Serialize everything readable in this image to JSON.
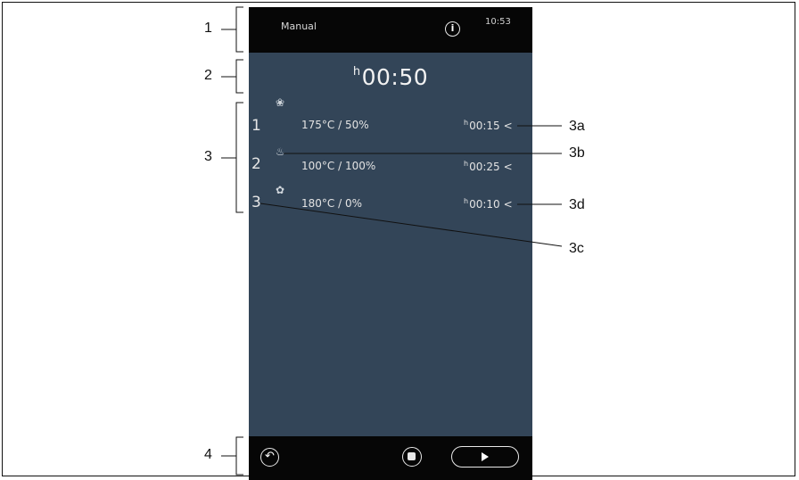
{
  "screen": {
    "mode_label": "Manual",
    "time": "10:53",
    "info_icon": "i",
    "total_time_prefix": "h",
    "total_time": "00:50",
    "steps": [
      {
        "number": "1",
        "icon": "hot-air-fan-icon",
        "icon_glyph": "❀",
        "setting": "175°C / 50%",
        "time_prefix": "h",
        "time": "00:15",
        "chevron": "<"
      },
      {
        "number": "2",
        "icon": "steam-icon",
        "icon_glyph": "♨",
        "setting": "100°C / 100%",
        "time_prefix": "h",
        "time": "00:25",
        "chevron": "<"
      },
      {
        "number": "3",
        "icon": "fan-icon",
        "icon_glyph": "✿",
        "setting": "180°C / 0%",
        "time_prefix": "h",
        "time": "00:10",
        "chevron": "<"
      }
    ],
    "back_icon": "↶"
  },
  "callouts": [
    "1",
    "2",
    "3",
    "4",
    "3a",
    "3b",
    "3c",
    "3d"
  ]
}
